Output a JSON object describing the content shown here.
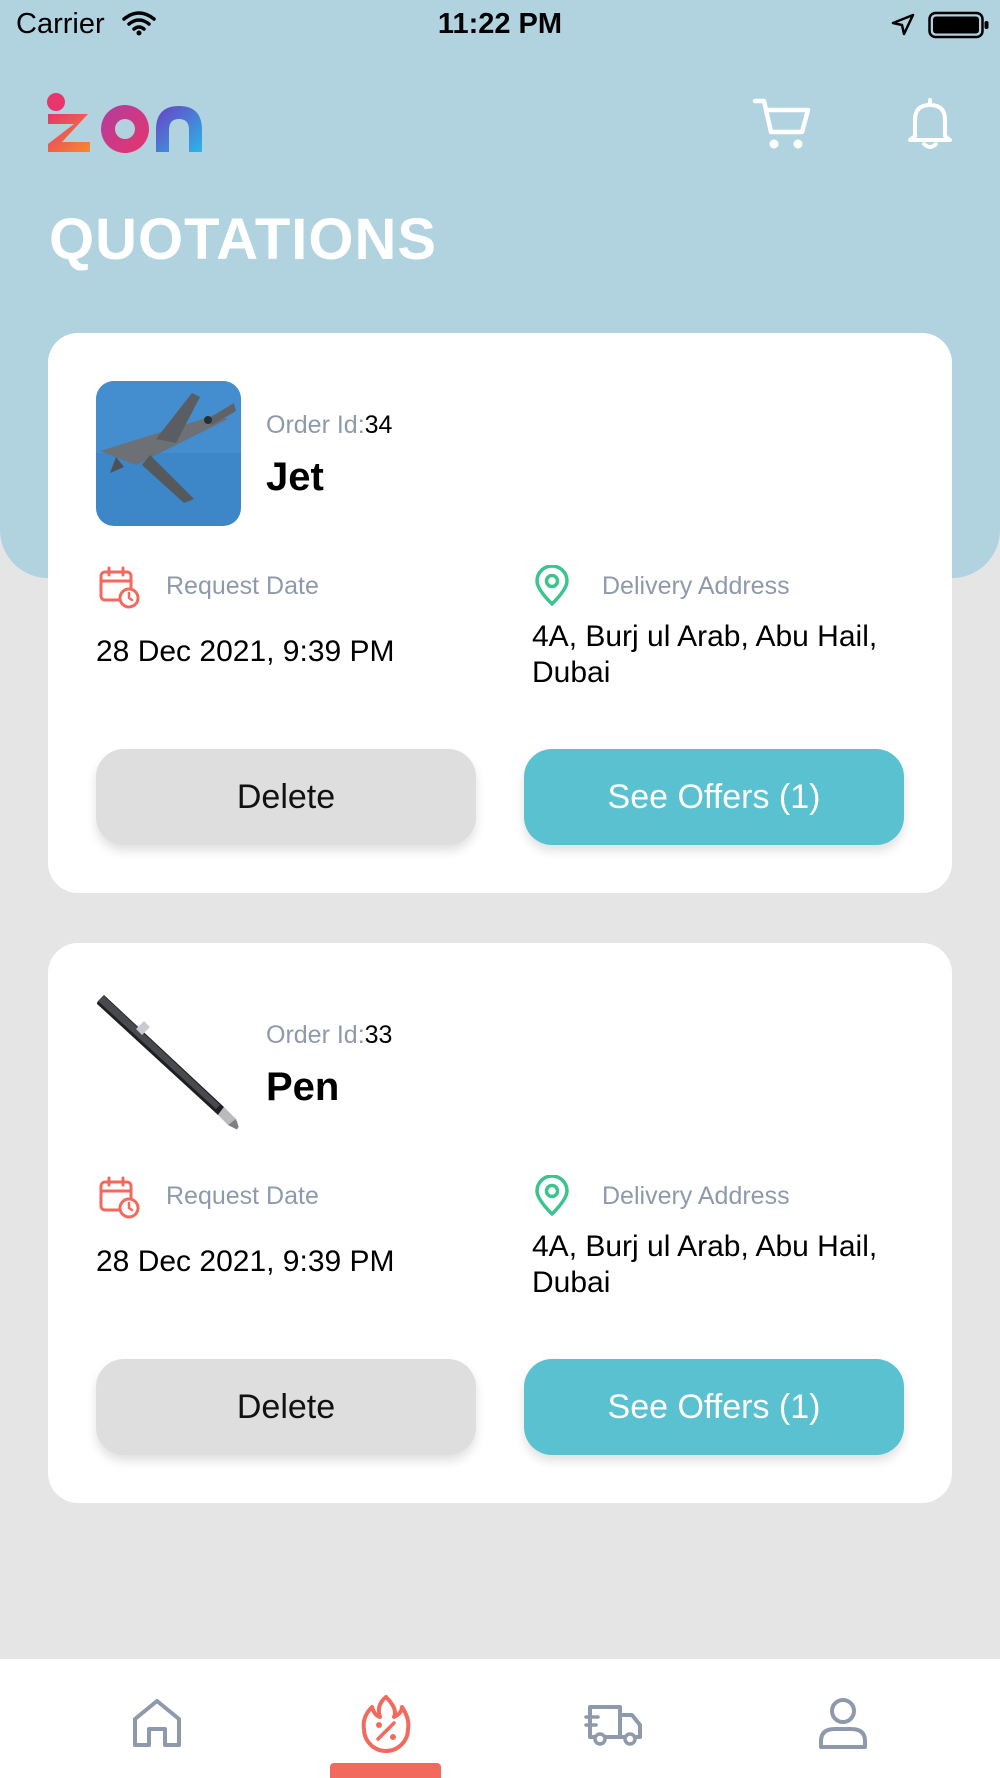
{
  "status_bar": {
    "carrier": "Carrier",
    "time": "11:22 PM"
  },
  "header": {
    "title": "QUOTATIONS",
    "icons": [
      "cart-icon",
      "bell-icon"
    ]
  },
  "orders": [
    {
      "order_id_label": "Order Id:",
      "order_id": "34",
      "name": "Jet",
      "request_date_label": "Request Date",
      "request_date": "28 Dec 2021, 9:39 PM",
      "delivery_address_label": "Delivery Address",
      "delivery_address": "4A, Burj ul Arab, Abu Hail, Dubai",
      "delete_label": "Delete",
      "offers_label": "See Offers (1)"
    },
    {
      "order_id_label": "Order Id:",
      "order_id": "33",
      "name": "Pen",
      "request_date_label": "Request Date",
      "request_date": "28 Dec 2021, 9:39 PM",
      "delivery_address_label": "Delivery Address",
      "delivery_address": "4A, Burj ul Arab, Abu Hail, Dubai",
      "delete_label": "Delete",
      "offers_label": "See Offers (1)"
    }
  ],
  "tab_bar": {
    "tabs": [
      "home-icon",
      "offers-icon",
      "delivery-truck-icon",
      "profile-icon"
    ],
    "active_tab": "offers-icon"
  },
  "colors": {
    "header_background": "#b1d2df",
    "accent_teal": "#59c1cf",
    "accent_coral": "#f26a5e",
    "pin_green": "#3cc48f"
  }
}
